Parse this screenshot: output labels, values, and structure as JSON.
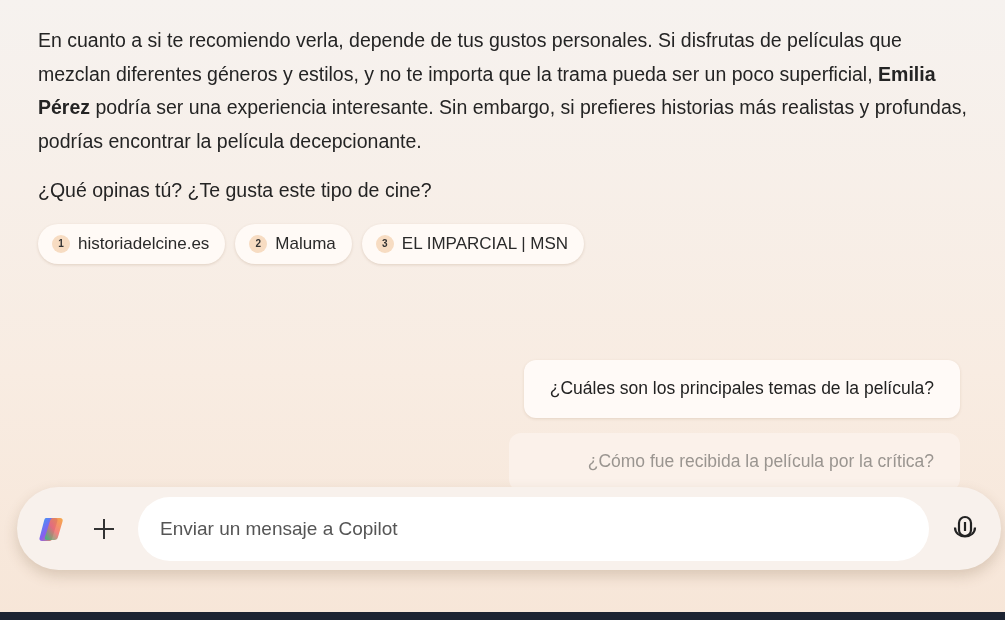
{
  "message": {
    "paragraphs": [
      "En cuanto a si te recomiendo verla, depende de tus gustos personales. Si disfrutas de películas que mezclan diferentes géneros y estilos, y no te importa que la trama pueda ser un poco superficial, **Emilia Pérez** podría ser una experiencia interesante. Sin embargo, si prefieres historias más realistas y profundas, podrías encontrar la película decepcionante.",
      "¿Qué opinas tú? ¿Te gusta este tipo de cine?"
    ],
    "citations": [
      {
        "number": "1",
        "label": "historiadelcine.es"
      },
      {
        "number": "2",
        "label": "Maluma"
      },
      {
        "number": "3",
        "label": "EL IMPARCIAL | MSN"
      }
    ]
  },
  "suggestions": [
    {
      "text": "¿Cuáles son los principales temas de la película?",
      "dimmed": false
    },
    {
      "text": "¿Cómo fue recibida la película por la crítica?",
      "dimmed": true
    }
  ],
  "composer": {
    "placeholder": "Enviar un mensaje a Copilot"
  }
}
